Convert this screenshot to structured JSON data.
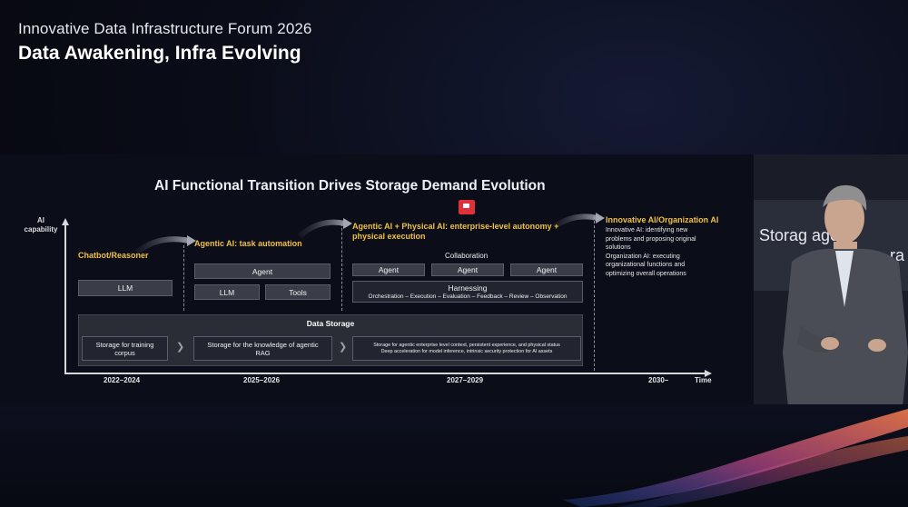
{
  "event": {
    "title": "Innovative Data Infrastructure Forum 2026",
    "subtitle": "Data Awakening, Infra Evolving"
  },
  "slide": {
    "title": "AI Functional Transition Drives Storage Demand Evolution",
    "y_axis_label": "AI capability",
    "x_axis_label": "Time",
    "periods": [
      "2022–2024",
      "2025–2026",
      "2027–2029",
      "2030–"
    ],
    "stages": [
      {
        "label": "Chatbot/Reasoner",
        "boxes": [
          "LLM"
        ]
      },
      {
        "label": "Agentic AI: task automation",
        "boxes": [
          "Agent",
          "LLM",
          "Tools"
        ]
      },
      {
        "label": "Agentic AI + Physical AI: enterprise-level autonomy + physical execution",
        "collaboration_label": "Collaboration",
        "agents": [
          "Agent",
          "Agent",
          "Agent"
        ],
        "harnessing_title": "Harnessing",
        "harnessing_detail": "Orchestration – Execution – Evaluation – Feedback – Review – Observation"
      },
      {
        "label": "Innovative AI/Organization AI",
        "desc": "Innovative AI: identifying new problems and proposing original solutions\nOrganization AI: executing organizational functions and optimizing overall operations"
      }
    ],
    "data_storage": {
      "title": "Data Storage",
      "items": [
        "Storage for training corpus",
        "Storage for the knowledge of agentic RAG",
        "Storage for agentic enterprise level context, persistent experience, and physical status\nDeep acceleration for model inference, intrinsic security protection for AI assets"
      ]
    }
  },
  "presenter_screen": {
    "text_line1": "Storag  agent",
    "text_line2": "ra"
  },
  "colors": {
    "accent_yellow": "#f0c040",
    "flag_red": "#e0303a",
    "background": "#07080f"
  },
  "icons": [
    "red-flag-icon",
    "arrow-right-icon",
    "chevron-right-icon"
  ]
}
